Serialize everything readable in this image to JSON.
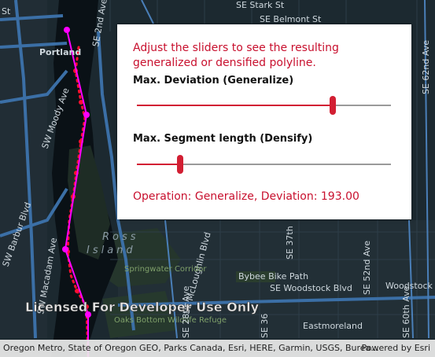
{
  "panel": {
    "instruction": "Adjust the sliders to see the resulting generalized or densified polyline.",
    "deviation_label": "Max. Deviation (Generalize)",
    "deviation_level": 0.77,
    "segment_label": "Max. Segment length (Densify)",
    "segment_level": 0.17,
    "result_text": "Operation: Generalize, Deviation: 193.00"
  },
  "map": {
    "watermark": "Licensed For Developer Use Only",
    "labels": {
      "portland": "Portland",
      "stark": "SE Stark St",
      "belmont": "SE Belmont St",
      "sw_moody": "SW Moody Ave",
      "sw_barbur": "SW Barbur Blvd",
      "sw_macadam": "SW Macadam Ave",
      "se_2nd": "SE 2nd Ave",
      "se_mcloughlin": "SE McLoughlin Blvd",
      "se_woodstock": "SE Woodstock Blvd",
      "woodstock": "Woodstock",
      "bybee": "Bybee Bike Path",
      "springwater": "Springwater Corridor",
      "oaks": "Oaks Bottom Wildlife Refuge",
      "eastmoreland": "Eastmoreland",
      "se_62nd": "SE 62nd Ave",
      "se_52nd": "SE 52nd Ave",
      "se_60th": "SE 60th Ave",
      "se_28th": "SE 28th Ave",
      "se_37th": "SE 37th",
      "se_36": "SE 36",
      "st": "St",
      "island_ross": "Ross",
      "island_island": "Island"
    }
  },
  "attribution": {
    "sources": "Oregon Metro, State of Oregon GEO, Parks Canada, Esri, HERE, Garmin, USGS, Burea...",
    "powered": "Powered by Esri"
  },
  "colors": {
    "accent": "#d21f33",
    "polyline": "#ff00ff",
    "original_line": "#ff1030"
  }
}
